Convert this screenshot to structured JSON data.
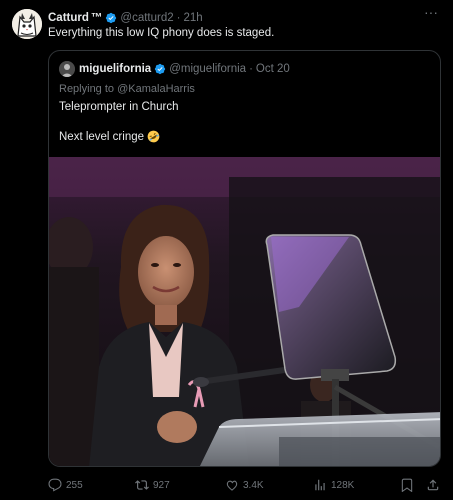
{
  "tweet": {
    "author_name": "Catturd",
    "author_tm": "™",
    "author_handle": "@catturd2",
    "separator": "·",
    "time": "21h",
    "text": "Everything this low IQ phony does is staged."
  },
  "quoted": {
    "author_name": "miguelifornia",
    "author_handle": "@miguelifornia",
    "separator": "·",
    "date": "Oct 20",
    "reply_prefix": "Replying to",
    "reply_handle": "@KamalaHarris",
    "line1": "Teleprompter in Church",
    "line2": "Next level cringe",
    "emoji_icon": "rolling-on-floor-laughing-emoji"
  },
  "actions": {
    "replies": "255",
    "reposts": "927",
    "likes": "3.4K",
    "views": "128K"
  },
  "colors": {
    "background": "#000000",
    "text": "#e7e9ea",
    "muted": "#71767b",
    "verified": "#1d9bf0",
    "border": "#2f3336"
  }
}
